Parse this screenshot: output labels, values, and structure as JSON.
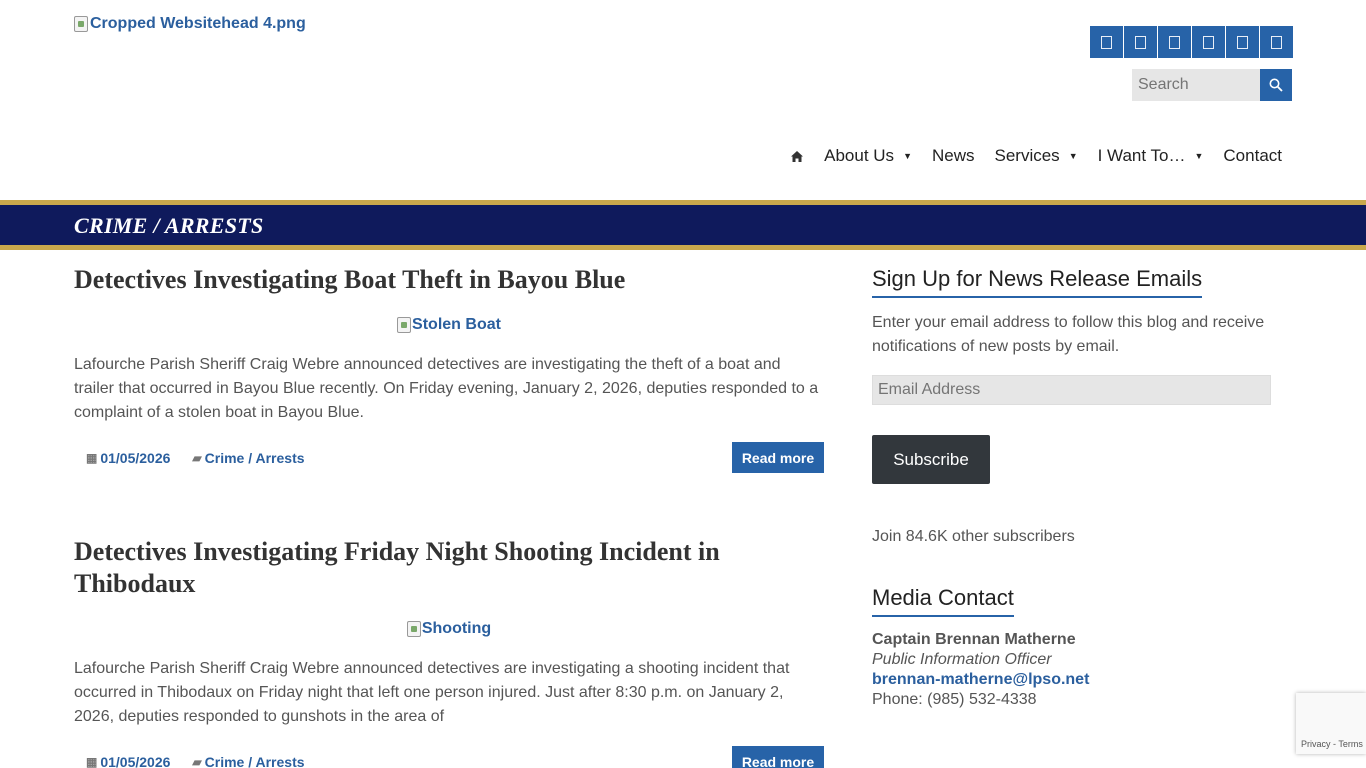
{
  "header": {
    "logo_alt": "Cropped Websitehead 4.png",
    "social_icons": [
      "social-icon-1",
      "social-icon-2",
      "social-icon-3",
      "social-icon-4",
      "social-icon-5",
      "social-icon-6"
    ],
    "search": {
      "placeholder": "Search"
    }
  },
  "nav": {
    "home_icon": "home-icon",
    "items": [
      {
        "label": "About Us",
        "has_dropdown": true
      },
      {
        "label": "News",
        "has_dropdown": false
      },
      {
        "label": "Services",
        "has_dropdown": true
      },
      {
        "label": "I Want To…",
        "has_dropdown": true
      },
      {
        "label": "Contact",
        "has_dropdown": false
      }
    ]
  },
  "banner": {
    "title": "CRIME / ARRESTS"
  },
  "posts": [
    {
      "title": "Detectives Investigating Boat Theft in Bayou Blue",
      "image_alt": "Stolen Boat",
      "excerpt": "Lafourche Parish Sheriff Craig Webre announced detectives are investigating the theft of a boat and trailer that occurred in Bayou Blue recently. On Friday evening, January 2, 2026, deputies responded to a complaint of a stolen boat in Bayou Blue.",
      "date": "01/05/2026",
      "category": "Crime / Arrests",
      "read_more": "Read more"
    },
    {
      "title": "Detectives Investigating Friday Night Shooting Incident in Thibodaux",
      "image_alt": "Shooting",
      "excerpt": "Lafourche Parish Sheriff Craig Webre announced detectives are investigating a shooting incident that occurred in Thibodaux on Friday night that left one person injured. Just after 8:30 p.m. on January 2, 2026, deputies responded to gunshots in the area of",
      "date": "01/05/2026",
      "category": "Crime / Arrests",
      "read_more": "Read more"
    }
  ],
  "sidebar": {
    "signup": {
      "title": "Sign Up for News Release Emails",
      "text": "Enter your email address to follow this blog and receive notifications of new posts by email.",
      "email_placeholder": "Email Address",
      "button": "Subscribe",
      "subscribers": "Join 84.6K other subscribers"
    },
    "media": {
      "title": "Media Contact",
      "name": "Captain Brennan Matherne",
      "role": "Public Information Officer",
      "email": "brennan-matherne@lpso.net",
      "phone": "Phone: (985) 532-4338"
    }
  },
  "recaptcha": {
    "privacy": "Privacy",
    "sep": " - ",
    "terms": "Terms"
  },
  "colors": {
    "brand_blue": "#2763a8",
    "banner_navy": "#0f1a5c",
    "banner_gold": "#c9a84c"
  }
}
